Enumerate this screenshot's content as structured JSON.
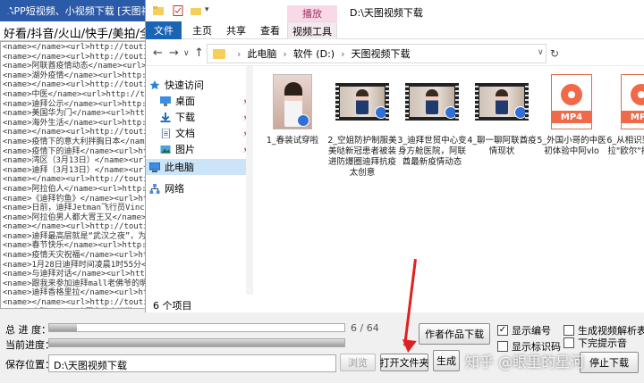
{
  "app": {
    "title": "APP短视频、小视频下载 [天图视频",
    "platforms": "好看/抖音/火山/快手/美拍/全",
    "log_lines": [
      "<name></name><url>http://toutiao.com",
      "<name></name><url>http://toutiao.com",
      "<name>阿联酋疫情动态</name><url>http",
      "<name>湖外疫情</name><url>http://toutia",
      "<name></name><url>http://toutiao.com",
      "<name>中医</name><url>http://toutia",
      "<name>迪拜公示</name><url>http://toutiao",
      "<name>美国华为门</name><url>http://toutia",
      "<name>海外生活</name><url>http://toutia",
      "<name></name><url>http://toutiao.com",
      "<name>疫情下的意大利拌胸日本</name>",
      "<name>疫情下的迪拜</name><url>http:",
      "<name>湾区（3月13日）</name><url>http",
      "<name>迪拜（3月13日）</name><url>h",
      "<name></name><url>http://toutiao.com",
      "<name>阿拉伯人</name><url>http://toutia",
      "<name>《迪拜钓鱼》</name><url>http:",
      "<name>日前，迪拜Jetman飞行员VinceRef",
      "<name>阿拉伯男人都大胃王又</name>",
      "<name></name><url>http://toutiao.com",
      "<name>迪拜最高层就是“武汉之夜”，为",
      "<name>春节快乐</name><url>http://touti",
      "<name>疫情天灾祝福</name><url>http",
      "<name>1月28日迪拜时间凌晨1时55分</name>",
      "<name>与迪拜对话</name><url>http://t",
      "<name>跟我来参加迪拜mall老佛爷的明人",
      "<name>迪拜香格里拉</name><url>htt",
      "<name></name><url>http://toutiao.com",
      "<name>中阿vlog27迪拜春节大巡游</name>",
      "<name>centralhotel</name><url>http",
      "<name>迪拜凉鞋街</name><url>http://",
      "<name>海归主播面试官给你的建议</name>",
      "<name>2020迪拜世界最高时装周</name>",
      "<name>迪拜你好的那年中国年</name>"
    ],
    "total_progress_label": "总 进 度：",
    "total_progress_text": "6 / 64",
    "total_progress_value": 0.094,
    "current_progress_label": "当前进度：",
    "current_progress_value": 1.0,
    "save_location_label": "保存位置：",
    "save_location_value": "D:\\天图视频下载",
    "browse_label": "浏览",
    "open_folder_label": "打开文件夹",
    "generate_label": "生成",
    "works_download_label": "作者作品下载",
    "cb_show_number": "显示编号",
    "cb_show_watermark": "显示标识码",
    "cb_gen_table": "生成视频解析表格",
    "cb_download_audio": "下完提示音",
    "stop_label": "停止下载"
  },
  "explorer": {
    "manage_tab": "播放",
    "title_path": "D:\\天图视频下载",
    "ribbon_tabs": [
      "文件",
      "主页",
      "共享",
      "查看",
      "视频工具"
    ],
    "breadcrumb": [
      "此电脑",
      "软件 (D:)",
      "天图视频下载"
    ],
    "nav": {
      "quick_access": "快速访问",
      "desktop": "桌面",
      "downloads": "下载",
      "documents": "文档",
      "pictures": "图片",
      "this_pc": "此电脑",
      "network": "网络"
    },
    "files": [
      {
        "name": "1_春装试穿啦",
        "kind": "portrait"
      },
      {
        "name": "2_空姐防护制服美美哒新冠患者被装进防爆圈迪拜抗疫太创意",
        "kind": "film"
      },
      {
        "name": "3_迪拜世贸中心变身方舱医院，阿联酋最新疫情动态",
        "kind": "film"
      },
      {
        "name": "4_聊一聊阿联酋疫情现状",
        "kind": "film"
      },
      {
        "name": "5_外国小哥的中医初体验中阿vlo",
        "kind": "mp4"
      },
      {
        "name": "6_从相识到恋爱，拉\"欧尔\"打怪进阶",
        "kind": "mp4"
      }
    ],
    "status": "6 个项目"
  },
  "watermark": "知乎 @眼里的星河"
}
